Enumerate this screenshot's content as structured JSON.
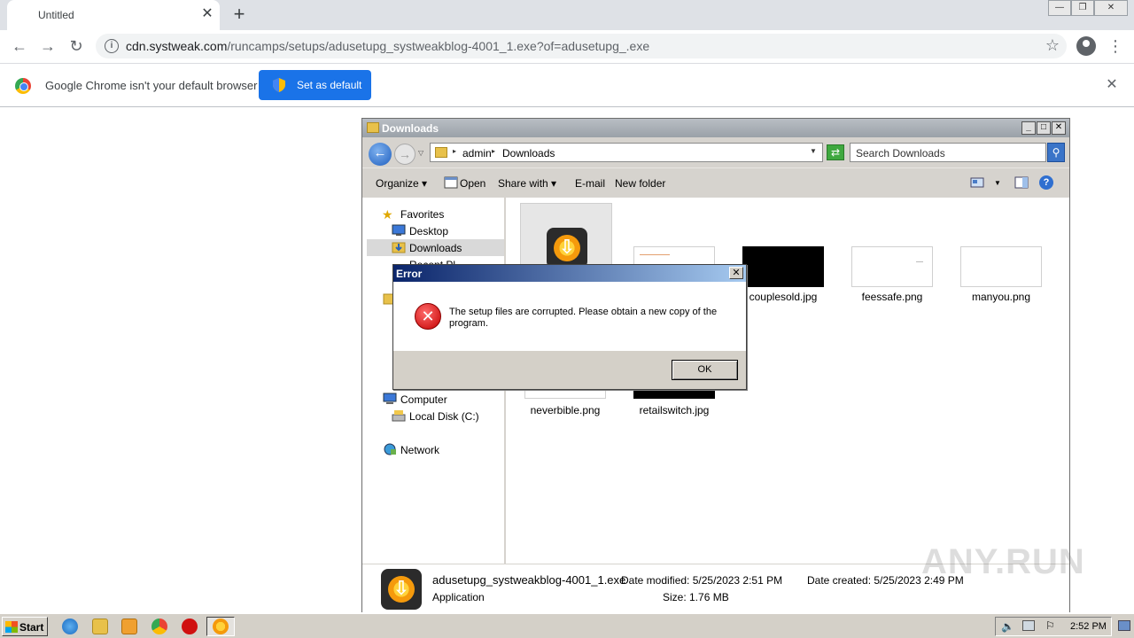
{
  "browser": {
    "tab_title": "Untitled",
    "tab_close": "✕",
    "new_tab": "+",
    "url_host": "cdn.systweak.com",
    "url_path": "/runcamps/setups/adusetupg_systweakblog-4001_1.exe?of=adusetupg_.exe",
    "infobar_text": "Google Chrome isn't your default browser",
    "set_default_label": "Set as default",
    "infobar_close": "✕"
  },
  "explorer": {
    "title": "Downloads",
    "breadcrumb": [
      "admin",
      "Downloads"
    ],
    "search_placeholder": "Search Downloads",
    "commands": [
      "Organize",
      "Open",
      "Share with",
      "E-mail",
      "New folder"
    ],
    "nav": {
      "favorites": "Favorites",
      "desktop": "Desktop",
      "downloads": "Downloads",
      "recent": "Recent Pl",
      "computer": "Computer",
      "local_disk": "Local Disk (C:)",
      "network": "Network"
    },
    "files": [
      {
        "name": "couplesold.jpg"
      },
      {
        "name": "feessafe.png"
      },
      {
        "name": "manyou.png"
      },
      {
        "name": "neverbible.png"
      },
      {
        "name": "retailswitch.jpg"
      }
    ],
    "details": {
      "filename": "adusetupg_systweakblog-4001_1.exe",
      "type": "Application",
      "date_modified": "Date modified: 5/25/2023 2:51 PM",
      "size": "Size: 1.76 MB",
      "date_created": "Date created: 5/25/2023 2:49 PM"
    }
  },
  "dialog": {
    "title": "Error",
    "message": "The setup files are corrupted. Please obtain a new copy of the program.",
    "ok_label": "OK",
    "close": "✕"
  },
  "taskbar": {
    "start_label": "Start",
    "clock": "2:52 PM"
  },
  "watermark": "ANY.RUN",
  "colors": {
    "chrome_accent": "#1a73e8",
    "dialog_title": "#0a246a",
    "error_red": "#c40000"
  }
}
